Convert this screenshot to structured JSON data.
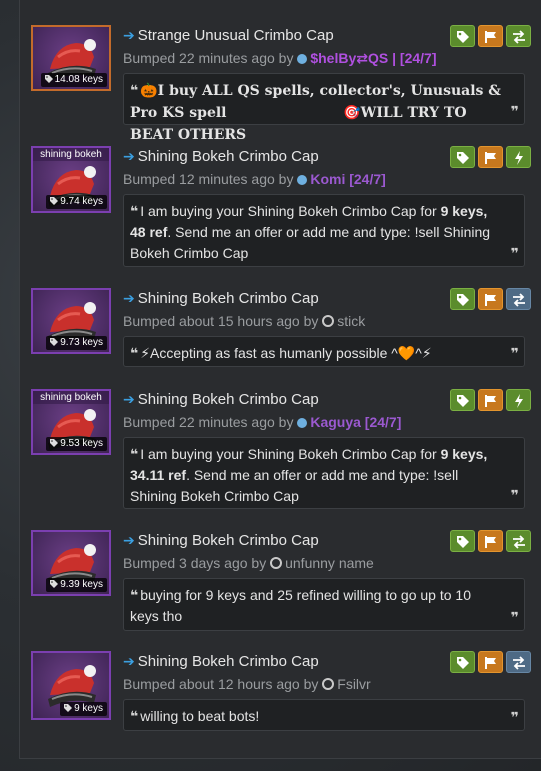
{
  "colors": {
    "username_purple": "#9b59d0",
    "username_blue": "#6fb0e0",
    "strange_border": "#c36b2b",
    "unusual_border": "#7b3fb0"
  },
  "listings": [
    {
      "title": "Strange Unusual Crimbo Cap",
      "price": "14.08 keys",
      "thumb_label": "",
      "bumped_prefix": "Bumped 22 minutes ago by",
      "user": "$helBy⇄QS | [24/7]",
      "message_a": "🎃I buy ALL QS spells, collector's, Unusuals & Pro KS spell",
      "message_b": "🎯WILL TRY TO BEAT OTHERS",
      "buttons": [
        "tag-icon",
        "flag-icon",
        "swap-icon"
      ]
    },
    {
      "title": "Shining Bokeh Crimbo Cap",
      "price": "9.74 keys",
      "thumb_label": "shining bokeh",
      "bumped_prefix": "Bumped 12 minutes ago by",
      "user": "Komi [24/7]",
      "message_a": "I am buying your Shining Bokeh Crimbo Cap for ",
      "message_bold": "9 keys, 48 ref",
      "message_c": ". Send me an offer or add me and type: !sell Shining Bokeh Crimbo Cap",
      "buttons": [
        "tag-icon",
        "flag-icon",
        "lightning-icon"
      ]
    },
    {
      "title": "Shining Bokeh Crimbo Cap",
      "price": "9.73 keys",
      "thumb_label": "",
      "bumped_prefix": "Bumped about 15 hours ago by",
      "user": "stick",
      "message_a": "⚡Accepting as fast as humanly possible ^🧡^⚡",
      "buttons": [
        "tag-icon",
        "flag-icon",
        "swap-icon"
      ]
    },
    {
      "title": "Shining Bokeh Crimbo Cap",
      "price": "9.53 keys",
      "thumb_label": "shining bokeh",
      "bumped_prefix": "Bumped 22 minutes ago by",
      "user": "Kaguya [24/7]",
      "message_a": "I am buying your Shining Bokeh Crimbo Cap for ",
      "message_bold": "9 keys, 34.11 ref",
      "message_c": ". Send me an offer or add me and type: !sell Shining Bokeh Crimbo Cap",
      "buttons": [
        "tag-icon",
        "flag-icon",
        "lightning-icon"
      ]
    },
    {
      "title": "Shining Bokeh Crimbo Cap",
      "price": "9.39 keys",
      "thumb_label": "",
      "bumped_prefix": "Bumped 3 days ago by",
      "user": "unfunny name",
      "message_a": "buying for 9 keys and 25 refined willing to go up to 10 keys tho",
      "buttons": [
        "tag-icon",
        "flag-icon",
        "swap-icon"
      ]
    },
    {
      "title": "Shining Bokeh Crimbo Cap",
      "price": "9 keys",
      "thumb_label": "",
      "bumped_prefix": "Bumped about 12 hours ago by",
      "user": "Fsilvr",
      "message_a": "willing to beat bots!",
      "buttons": [
        "tag-icon",
        "flag-icon",
        "swap-icon"
      ]
    }
  ]
}
